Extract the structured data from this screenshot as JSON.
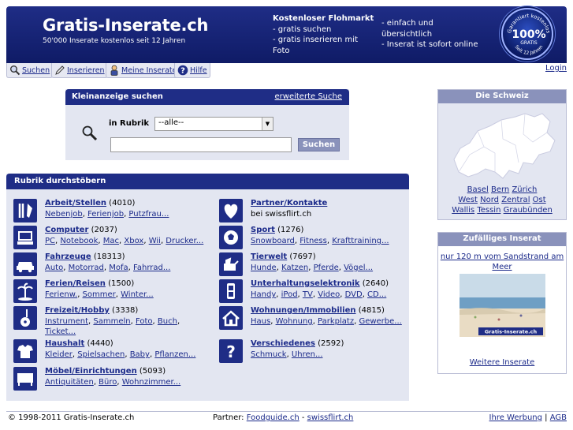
{
  "header": {
    "logo": "Gratis-Inserate.ch",
    "tagline": "50'000 Inserate  kostenlos  seit 12 Jahren",
    "promo_title": "Kostenloser Flohmarkt",
    "promo_items": [
      "- gratis suchen",
      "- gratis inserieren mit",
      "Foto"
    ],
    "promo_items2": [
      "- einfach und",
      "übersichtlich",
      "- Inserat ist sofort online"
    ],
    "seal": {
      "top": "Garantiert kostenlos",
      "mid": "100%",
      "sub": "GRATIS",
      "bottom": "Seit 12 Jahren"
    }
  },
  "nav": {
    "items": [
      "Suchen",
      "Inserieren",
      "Meine Inserate",
      "Hilfe"
    ],
    "login": "Login"
  },
  "search": {
    "title": "Kleinanzeige suchen",
    "advanced": "erweiterte Suche",
    "rubrik_label": "in Rubrik",
    "rubrik_value": "--alle--",
    "query_value": "",
    "button": "Suchen"
  },
  "categories": {
    "title": "Rubrik durchstöbern",
    "items": [
      {
        "name": "Arbeit/Stellen",
        "count": "(4010)",
        "subs": [
          "Nebenjob",
          "Ferienjob",
          "Putzfrau..."
        ]
      },
      {
        "name": "Partner/Kontakte",
        "count": "",
        "note": "bei swissflirt.ch",
        "subs": []
      },
      {
        "name": "Computer",
        "count": "(2037)",
        "subs": [
          "PC",
          "Notebook",
          "Mac",
          "Xbox",
          "Wii",
          "Drucker..."
        ]
      },
      {
        "name": "Sport",
        "count": "(1276)",
        "subs": [
          "Snowboard",
          "Fitness",
          "Krafttraining..."
        ]
      },
      {
        "name": "Fahrzeuge",
        "count": "(18313)",
        "subs": [
          "Auto",
          "Motorrad",
          "Mofa",
          "Fahrrad..."
        ]
      },
      {
        "name": "Tierwelt",
        "count": "(7697)",
        "subs": [
          "Hunde",
          "Katzen",
          "Pferde",
          "Vögel..."
        ]
      },
      {
        "name": "Ferien/Reisen",
        "count": "(1500)",
        "subs": [
          "Ferienw.",
          "Sommer",
          "Winter..."
        ]
      },
      {
        "name": "Unterhaltungselektronik",
        "count": "(2640)",
        "subs": [
          "Handy",
          "iPod",
          "TV",
          "Video",
          "DVD",
          "CD..."
        ]
      },
      {
        "name": "Freizeit/Hobby",
        "count": "(3338)",
        "subs": [
          "Instrument",
          "Sammeln",
          "Foto",
          "Buch",
          "Ticket..."
        ]
      },
      {
        "name": "Wohnungen/Immobilien",
        "count": "(4815)",
        "subs": [
          "Haus",
          "Wohnung",
          "Parkplatz",
          "Gewerbe..."
        ]
      },
      {
        "name": "Haushalt",
        "count": "(4440)",
        "subs": [
          "Kleider",
          "Spielsachen",
          "Baby",
          "Pflanzen..."
        ]
      },
      {
        "name": "Verschiedenes",
        "count": "(2592)",
        "subs": [
          "Schmuck",
          "Uhren..."
        ]
      },
      {
        "name": "Möbel/Einrichtungen",
        "count": "(5093)",
        "subs": [
          "Antiquitäten",
          "Büro",
          "Wohnzimmer..."
        ]
      }
    ]
  },
  "schweiz": {
    "title": "Die Schweiz",
    "rows": [
      [
        "Basel",
        "Bern",
        "Zürich"
      ],
      [
        "West",
        "Nord",
        "Zentral",
        "Ost"
      ],
      [
        "Wallis",
        "Tessin",
        "Graubünden"
      ]
    ]
  },
  "random": {
    "title": "Zufälliges Inserat",
    "ad_title": "nur 120 m vom Sandstrand am Meer",
    "watermark": "Gratis-Inserate.ch",
    "more": "Weitere Inserate"
  },
  "footer": {
    "copyright": "© 1998-2011 Gratis-Inserate.ch",
    "partner_label": "Partner:",
    "partners": [
      "Foodguide.ch",
      "swissflirt.ch"
    ],
    "right": [
      "Ihre Werbung",
      "AGB"
    ]
  }
}
